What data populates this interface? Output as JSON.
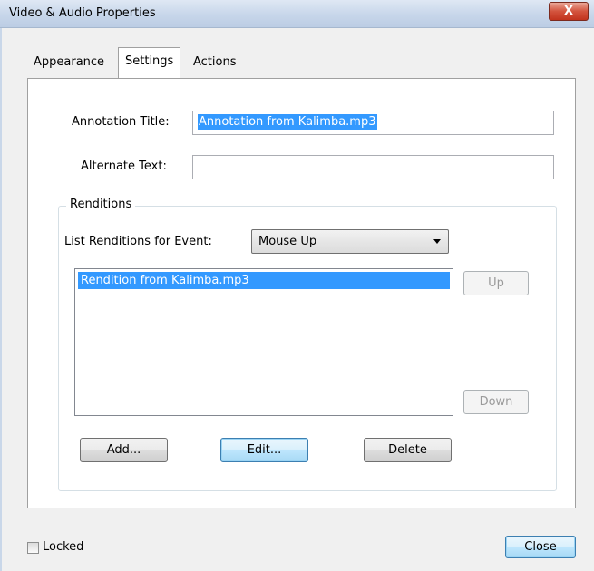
{
  "window": {
    "title": "Video & Audio Properties",
    "close_glyph": "X"
  },
  "tabs": [
    {
      "label": "Appearance",
      "active": false
    },
    {
      "label": "Settings",
      "active": true
    },
    {
      "label": "Actions",
      "active": false
    }
  ],
  "settings": {
    "annotation_title_label": "Annotation Title:",
    "annotation_title_value": "Annotation from Kalimba.mp3",
    "alternate_text_label": "Alternate Text:",
    "alternate_text_value": ""
  },
  "renditions": {
    "group_label": "Renditions",
    "event_label": "List Renditions for Event:",
    "event_selected": "Mouse Up",
    "items": [
      "Rendition from Kalimba.mp3"
    ],
    "up_label": "Up",
    "down_label": "Down",
    "add_label": "Add...",
    "edit_label": "Edit...",
    "delete_label": "Delete"
  },
  "footer": {
    "locked_label": "Locked",
    "locked_checked": false,
    "close_label": "Close"
  },
  "colors": {
    "selection": "#3399ff",
    "close_button": "#c2331d",
    "title_bar": "#c7d6ea"
  }
}
